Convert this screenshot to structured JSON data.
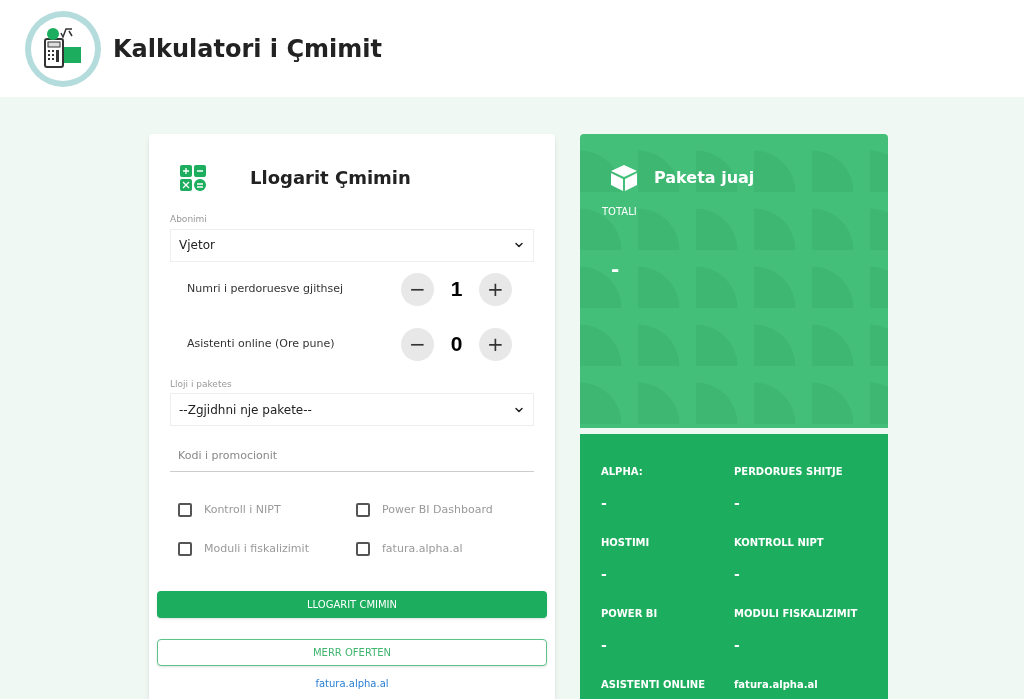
{
  "header": {
    "title": "Kalkulatori i Çmimit"
  },
  "calculator": {
    "title": "Llogarit Çmimin",
    "subscription": {
      "label": "Abonimi",
      "value": "Vjetor"
    },
    "counters": [
      {
        "label": "Numri i perdoruesve gjithsej",
        "minus": "−",
        "value": "1",
        "plus": "+"
      },
      {
        "label": "Asistenti online (Ore pune)",
        "minus": "−",
        "value": "0",
        "plus": "+"
      }
    ],
    "package": {
      "label": "Lloji i paketes",
      "value": "--Zgjidhni nje pakete--"
    },
    "promo": {
      "placeholder": "Kodi i promocionit"
    },
    "options": [
      {
        "label": "Kontroll i NIPT",
        "checked": false
      },
      {
        "label": "Power BI Dashboard",
        "checked": false
      },
      {
        "label": "Moduli i fiskalizimit",
        "checked": false
      },
      {
        "label": "fatura.alpha.al",
        "checked": false
      }
    ],
    "calculate_button": "LLOGARIT CMIMIN",
    "offer_button": "MERR OFERTEN",
    "link": "fatura.alpha.al"
  },
  "package_card": {
    "title": "Paketa juaj",
    "total_label": "TOTALI",
    "total_value": "-"
  },
  "summary": [
    {
      "label": "ALPHA:",
      "value": "-"
    },
    {
      "label": "PERDORUES SHITJE",
      "value": "-"
    },
    {
      "label": "HOSTIMI",
      "value": "-"
    },
    {
      "label": "KONTROLL NIPT",
      "value": "-"
    },
    {
      "label": "POWER BI",
      "value": "-"
    },
    {
      "label": "MODULI FISKALIZIMIT",
      "value": "-"
    },
    {
      "label": "ASISTENTI ONLINE"
    },
    {
      "label": "fatura.alpha.al"
    }
  ]
}
